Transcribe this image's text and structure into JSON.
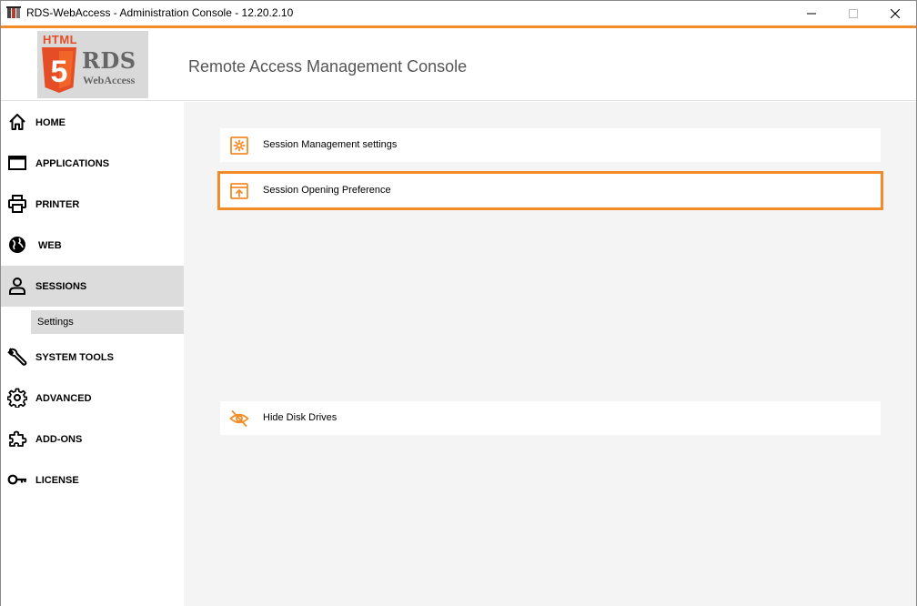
{
  "window": {
    "title": "RDS-WebAccess - Administration Console - 12.20.2.10"
  },
  "header": {
    "logo": {
      "html_text": "HTML",
      "shield_glyph": "5",
      "rds_text": "RDS",
      "webaccess_text": "WebAccess"
    },
    "console_title": "Remote Access Management Console"
  },
  "sidebar": {
    "items": [
      {
        "label": "HOME",
        "icon": "home-icon"
      },
      {
        "label": "APPLICATIONS",
        "icon": "window-icon"
      },
      {
        "label": "PRINTER",
        "icon": "printer-icon"
      },
      {
        "label": "WEB",
        "icon": "globe-icon"
      },
      {
        "label": "SESSIONS",
        "icon": "user-icon",
        "active": true
      },
      {
        "label": "SYSTEM TOOLS",
        "icon": "wrench-icon"
      },
      {
        "label": "ADVANCED",
        "icon": "gear-icon"
      },
      {
        "label": "ADD-ONS",
        "icon": "puzzle-icon"
      },
      {
        "label": "LICENSE",
        "icon": "key-icon"
      }
    ],
    "sub_item": {
      "label": "Settings"
    }
  },
  "main": {
    "cards": [
      {
        "label": "Session Management settings",
        "icon": "settings-gear-icon"
      },
      {
        "label": "Session Opening Preference",
        "icon": "open-window-icon",
        "highlighted": true
      },
      {
        "label": "Hide Disk Drives",
        "icon": "eye-hidden-icon"
      }
    ]
  },
  "colors": {
    "accent": "#f28c28",
    "active_nav": "#dcdcdc",
    "content_bg": "#f4f4f4"
  }
}
